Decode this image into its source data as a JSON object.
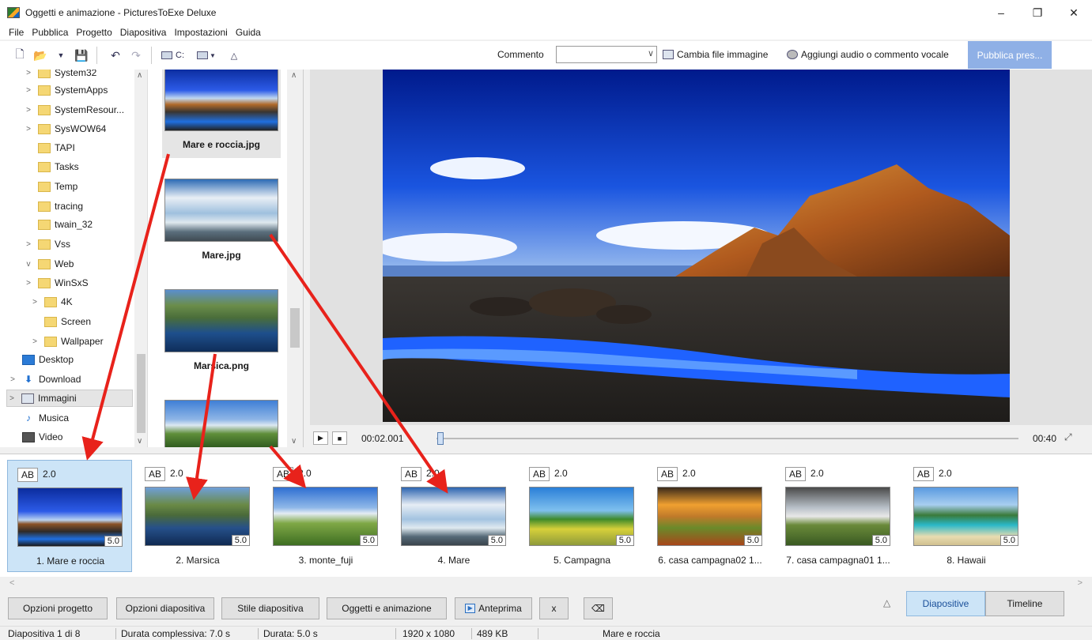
{
  "window": {
    "title": "Oggetti e animazione - PicturesToExe Deluxe",
    "controls": [
      "–",
      "❐",
      "✕"
    ]
  },
  "menu": [
    "File",
    "Pubblica",
    "Progetto",
    "Diapositiva",
    "Impostazioni",
    "Guida"
  ],
  "toolbar": {
    "drive_label": "C:",
    "comment_label": "Commento",
    "comment_value": "",
    "change_image_label": "Cambia file immagine",
    "add_audio_label": "Aggiungi audio o commento vocale",
    "publish_label": "Pubblica pres...",
    "publish_color": "#8fb0e6"
  },
  "tree": {
    "items": [
      {
        "label": "System32",
        "chevron": ">"
      },
      {
        "label": "SystemApps",
        "chevron": ">"
      },
      {
        "label": "SystemResour...",
        "chevron": ">"
      },
      {
        "label": "SysWOW64",
        "chevron": ">"
      },
      {
        "label": "TAPI",
        "chevron": ""
      },
      {
        "label": "Tasks",
        "chevron": ""
      },
      {
        "label": "Temp",
        "chevron": ""
      },
      {
        "label": "tracing",
        "chevron": ""
      },
      {
        "label": "twain_32",
        "chevron": ""
      },
      {
        "label": "Vss",
        "chevron": ">"
      },
      {
        "label": "Web",
        "chevron": "v"
      },
      {
        "label": "WinSxS",
        "chevron": ">"
      },
      {
        "label": "4K",
        "chevron": ">"
      },
      {
        "label": "Screen",
        "chevron": ""
      },
      {
        "label": "Wallpaper",
        "chevron": ">"
      },
      {
        "label": "Desktop",
        "chevron": ""
      },
      {
        "label": "Download",
        "chevron": ">"
      },
      {
        "label": "Immagini",
        "chevron": ">"
      },
      {
        "label": "Musica",
        "chevron": ""
      },
      {
        "label": "Video",
        "chevron": ""
      }
    ]
  },
  "files": [
    {
      "name": "Mare e roccia.jpg"
    },
    {
      "name": "Mare.jpg"
    },
    {
      "name": "Marsica.png"
    },
    {
      "name": ""
    }
  ],
  "player": {
    "current_time": "00:02.001",
    "total_time": "00:40",
    "progress_fraction": 0.0
  },
  "slides": [
    {
      "ab": "AB",
      "transition": "2.0",
      "duration": "5.0",
      "label": "1. Mare e roccia",
      "selected": true
    },
    {
      "ab": "AB",
      "transition": "2.0",
      "duration": "5.0",
      "label": "2. Marsica"
    },
    {
      "ab": "AB",
      "transition": "2.0",
      "duration": "5.0",
      "label": "3. monte_fuji"
    },
    {
      "ab": "AB",
      "transition": "2.0",
      "duration": "5.0",
      "label": "4. Mare"
    },
    {
      "ab": "AB",
      "transition": "2.0",
      "duration": "5.0",
      "label": "5. Campagna"
    },
    {
      "ab": "AB",
      "transition": "2.0",
      "duration": "5.0",
      "label": "6. casa campagna02 1..."
    },
    {
      "ab": "AB",
      "transition": "2.0",
      "duration": "5.0",
      "label": "7. casa campagna01 1..."
    },
    {
      "ab": "AB",
      "transition": "2.0",
      "duration": "5.0",
      "label": "8. Hawaii"
    }
  ],
  "bottom": {
    "project_options": "Opzioni progetto",
    "slide_options": "Opzioni diapositiva",
    "slide_style": "Stile diapositiva",
    "objects_animation": "Oggetti e animazione",
    "preview": "Anteprima",
    "x": "x",
    "tab_slides": "Diapositive",
    "tab_timeline": "Timeline"
  },
  "status": {
    "slide_pos": "Diapositiva 1 di 8",
    "total_duration": "Durata complessiva: 7.0 s",
    "duration": "Durata: 5.0 s",
    "resolution": "1920 x 1080",
    "size": "489 KB",
    "name": "Mare e roccia"
  },
  "colors": {
    "selection": "#cce4f7",
    "arrow": "#e8221b"
  }
}
